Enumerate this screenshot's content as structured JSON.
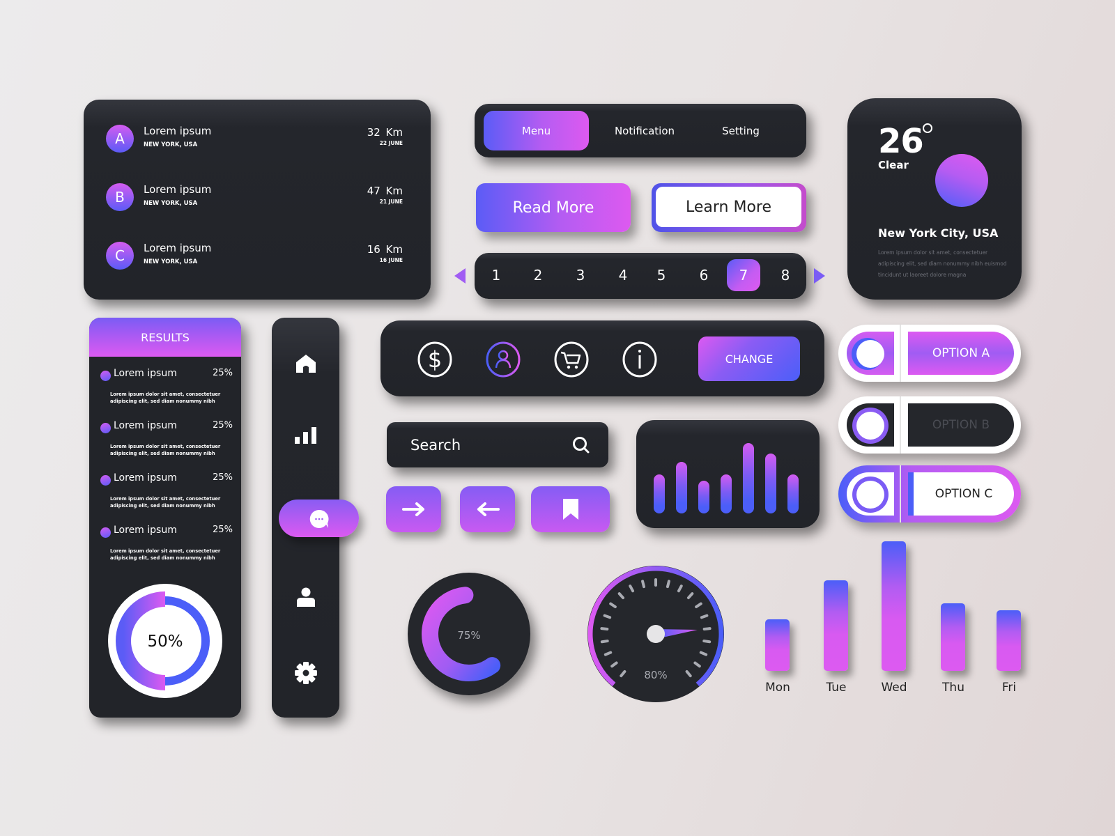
{
  "locations": [
    {
      "initial": "A",
      "title": "Lorem ipsum",
      "place": "NEW YORK, USA",
      "distance": "32 Km",
      "date": "22 JUNE"
    },
    {
      "initial": "B",
      "title": "Lorem ipsum",
      "place": "NEW YORK, USA",
      "distance": "47 Km",
      "date": "21 JUNE"
    },
    {
      "initial": "C",
      "title": "Lorem ipsum",
      "place": "NEW YORK, USA",
      "distance": "16 Km",
      "date": "16 JUNE"
    }
  ],
  "tabs": [
    {
      "label": "Menu",
      "active": true
    },
    {
      "label": "Notification",
      "active": false
    },
    {
      "label": "Setting",
      "active": false
    }
  ],
  "buttons": {
    "read_more": "Read More",
    "learn_more": "Learn More",
    "change": "CHANGE"
  },
  "pagination": {
    "pages": [
      "1",
      "2",
      "3",
      "4",
      "5",
      "6",
      "7",
      "8"
    ],
    "current": "7"
  },
  "weather": {
    "temperature": "26",
    "condition": "Clear",
    "city": "New York City, USA",
    "description": "Lorem ipsum dolor sit amet, consectetuer adipiscing elit, sed diam nonummy nibh euismod tincidunt ut laoreet dolore magna"
  },
  "results": {
    "title": "RESULTS",
    "items": [
      {
        "label": "Lorem ipsum",
        "percent": "25%",
        "desc": "Lorem ipsum dolor sit amet, consectetuer adipiscing elit, sed diam nonummy nibh"
      },
      {
        "label": "Lorem ipsum",
        "percent": "25%",
        "desc": "Lorem ipsum dolor sit amet, consectetuer adipiscing elit, sed diam nonummy nibh"
      },
      {
        "label": "Lorem ipsum",
        "percent": "25%",
        "desc": "Lorem ipsum dolor sit amet, consectetuer adipiscing elit, sed diam nonummy nibh"
      },
      {
        "label": "Lorem ipsum",
        "percent": "25%",
        "desc": "Lorem ipsum dolor sit amet, consectetuer adipiscing elit, sed diam nonummy nibh"
      }
    ],
    "ring_label": "50%",
    "ring_value": 0.5
  },
  "vertical_nav": [
    "home-icon",
    "signal-bars-icon",
    "chat-icon",
    "user-icon",
    "gear-icon"
  ],
  "icon_bar": [
    "dollar-icon",
    "user-icon",
    "cart-icon",
    "info-icon"
  ],
  "search": {
    "placeholder": "Search"
  },
  "nav_buttons": [
    "arrow-right-icon",
    "arrow-left-icon",
    "bookmark-icon"
  ],
  "equalizer": {
    "levels": [
      0.55,
      0.73,
      0.47,
      0.55,
      1.0,
      0.85,
      0.55
    ]
  },
  "options": [
    {
      "label": "OPTION A",
      "state": "active"
    },
    {
      "label": "OPTION B",
      "state": "disabled"
    },
    {
      "label": "OPTION C",
      "state": "outlined"
    }
  ],
  "progress_ring": {
    "label": "75%",
    "value": 0.75
  },
  "gauge": {
    "label": "80%",
    "value": 0.8
  },
  "chart_data": {
    "type": "bar",
    "title": "",
    "categories": [
      "Mon",
      "Tue",
      "Wed",
      "Thu",
      "Fri"
    ],
    "values": [
      40,
      70,
      100,
      52,
      47
    ],
    "xlabel": "",
    "ylabel": "",
    "ylim": [
      0,
      100
    ],
    "grid": false
  }
}
